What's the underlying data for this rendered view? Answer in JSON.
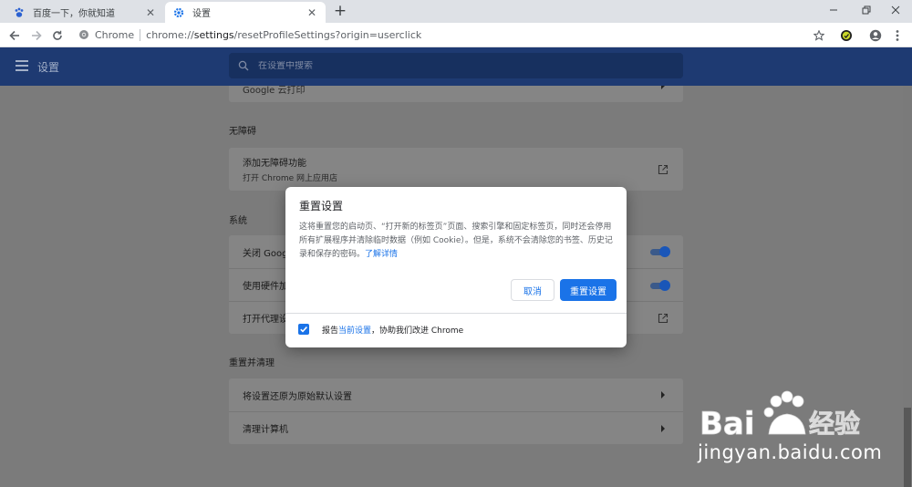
{
  "browser": {
    "tabs": [
      {
        "title": "百度一下，你就知道",
        "icon": "baidu-paw-icon",
        "active": false
      },
      {
        "title": "设置",
        "icon": "gear-icon",
        "active": true
      }
    ],
    "omnibox": {
      "site_label": "Chrome",
      "url_prefix": "chrome://",
      "url_host": "settings",
      "url_rest": "/resetProfileSettings?origin=userclick"
    }
  },
  "settings": {
    "header_title": "设置",
    "search_placeholder": "在设置中搜索",
    "partial_row": "Google 云打印",
    "sections": {
      "accessibility": {
        "title": "无障碍",
        "row_title": "添加无障碍功能",
        "row_subtitle": "打开 Chrome 网上应用店"
      },
      "system": {
        "title": "系统",
        "rows": [
          "关闭 Google",
          "使用硬件加",
          "打开代理设"
        ]
      },
      "reset": {
        "title": "重置并清理",
        "rows": [
          "将设置还原为原始默认设置",
          "清理计算机"
        ]
      }
    }
  },
  "dialog": {
    "title": "重置设置",
    "body": "这将重置您的启动页、“打开新的标签页”页面、搜索引擎和固定标签页，同时还会停用所有扩展程序并清除临时数据（例如 Cookie）。但是，系统不会清除您的书签、历史记录和保存的密码。",
    "learn_more": "了解详情",
    "cancel_label": "取消",
    "reset_label": "重置设置",
    "footer_prefix": "报告",
    "footer_link": "当前设置",
    "footer_suffix": "，协助我们改进 Chrome",
    "report_checked": true
  },
  "watermark": {
    "brand": "Bai 经验",
    "url": "jingyan.baidu.com"
  },
  "colors": {
    "accent": "#1a73e8",
    "header_bg": "#1e3a72",
    "overlay_page": "#7b7b7b"
  }
}
